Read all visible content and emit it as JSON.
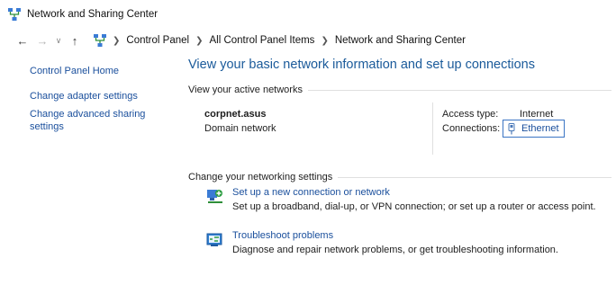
{
  "window": {
    "title": "Network and Sharing Center",
    "icon": "network-center-icon"
  },
  "navigation": {
    "back_icon": "back-arrow-icon",
    "forward_icon": "forward-arrow-icon",
    "recent_icon": "chevron-down-icon",
    "up_icon": "up-arrow-icon",
    "breadcrumb": [
      "Control Panel",
      "All Control Panel Items",
      "Network and Sharing Center"
    ]
  },
  "sidebar": {
    "home": "Control Panel Home",
    "items": [
      "Change adapter settings",
      "Change advanced sharing settings"
    ]
  },
  "main": {
    "heading": "View your basic network information and set up connections",
    "active_networks": {
      "section_title": "View your active networks",
      "network_name": "corpnet.asus",
      "network_type": "Domain network",
      "access_type_label": "Access type:",
      "access_type_value": "Internet",
      "connections_label": "Connections:",
      "connection_name": "Ethernet"
    },
    "change_settings": {
      "section_title": "Change your networking settings",
      "tasks": [
        {
          "icon": "new-connection-icon",
          "link": "Set up a new connection or network",
          "description": "Set up a broadband, dial-up, or VPN connection; or set up a router or access point."
        },
        {
          "icon": "troubleshoot-icon",
          "link": "Troubleshoot problems",
          "description": "Diagnose and repair network problems, or get troubleshooting information."
        }
      ]
    }
  },
  "colors": {
    "link": "#1a4f9c",
    "heading": "#1a5a9a",
    "focus_border": "#3b75c4"
  }
}
